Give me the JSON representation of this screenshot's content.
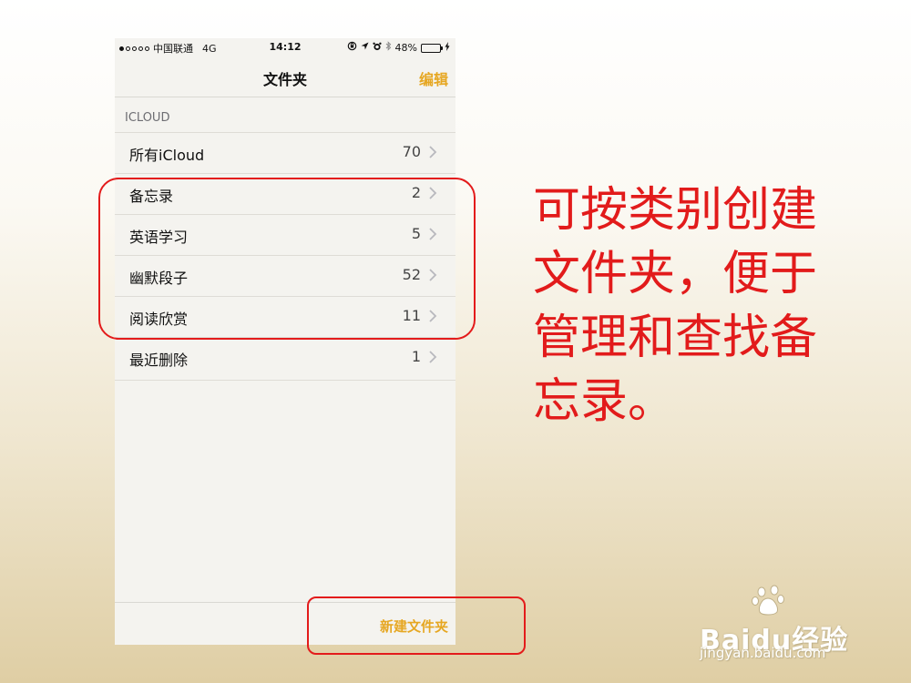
{
  "status_bar": {
    "carrier": "中国联通",
    "network": "4G",
    "time": "14:12",
    "battery": "48%",
    "battery_level": 0.48
  },
  "nav": {
    "title": "文件夹",
    "edit_label": "编辑"
  },
  "section": {
    "header": "ICLOUD"
  },
  "folders": [
    {
      "label": "所有iCloud",
      "count": "70"
    },
    {
      "label": "备忘录",
      "count": "2"
    },
    {
      "label": "英语学习",
      "count": "5"
    },
    {
      "label": "幽默段子",
      "count": "52"
    },
    {
      "label": "阅读欣赏",
      "count": "11"
    },
    {
      "label": "最近删除",
      "count": "1"
    }
  ],
  "toolbar": {
    "new_folder_label": "新建文件夹"
  },
  "annotation": {
    "caption": "可按类别创建文件夹，便于管理和查找备忘录。"
  },
  "watermark": {
    "brand": "Baidu经验",
    "url": "jingyan.baidu.com"
  },
  "colors": {
    "accent": "#e6a722",
    "annotation_red": "#e21b1b",
    "battery_green": "#4cd964"
  }
}
